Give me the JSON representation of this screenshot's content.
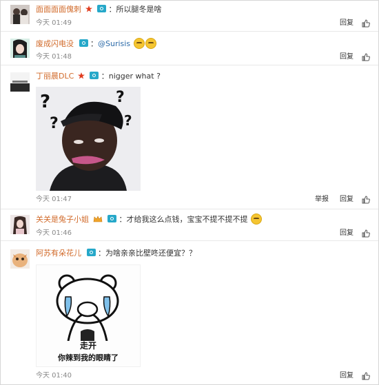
{
  "comments": [
    {
      "user": "面面面面傀刺",
      "text": "：所以腿冬是啥",
      "time": "今天 01:49",
      "reply": "回复"
    },
    {
      "user": "废成闪电没",
      "mention": "@Surisis",
      "time": "今天 01:48",
      "reply": "回复"
    },
    {
      "user": "丁丽晨DLC",
      "text": "：nigger what ?",
      "time": "今天 01:47",
      "report": "举报",
      "reply": "回复"
    },
    {
      "user": "关关是兔子小姐",
      "text": "：才给我这么点钱，宝宝不提不提不提",
      "time": "今天 01:46",
      "reply": "回复"
    },
    {
      "user": "阿苏有朵花儿",
      "text": "：为啥亲亲比壁咚还便宜？？",
      "time": "今天 01:40",
      "reply": "回复"
    }
  ],
  "sticker": {
    "line1": "走开",
    "line2": "你辣到我的眼睛了"
  },
  "colors": {
    "username": "#d16a2a",
    "mention": "#2b6aa8",
    "camera": "#26a8c9",
    "divider": "#e8e8e8"
  }
}
